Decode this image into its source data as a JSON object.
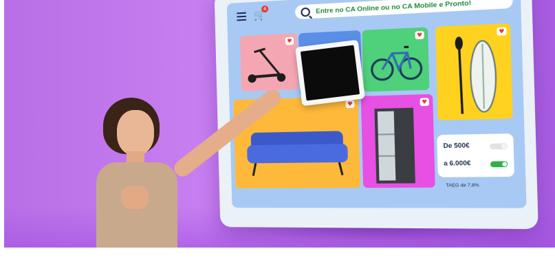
{
  "search": {
    "placeholder": "Entre no CA Online ou no CA Mobile e Pronto!"
  },
  "cart": {
    "badge": "4"
  },
  "loan": {
    "from_label": "De 500€",
    "to_label": "a 6.000€",
    "note": "TAEG de 7,8%"
  },
  "colors": {
    "background": "#b86fe6",
    "screen": "#a8c9f4",
    "accent_green": "#2fb04a",
    "badge_red": "#e23b3b"
  },
  "icons": [
    "menu-icon",
    "cart-icon",
    "search-icon",
    "heart-icon"
  ]
}
